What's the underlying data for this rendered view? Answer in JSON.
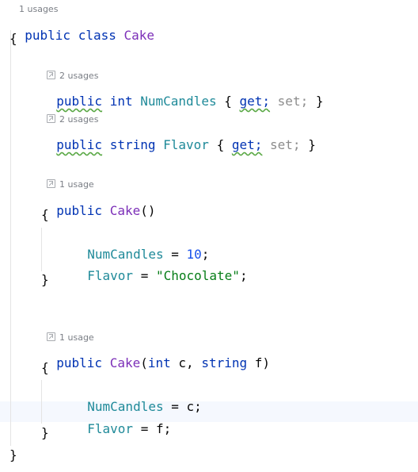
{
  "top_hint": "1 usages",
  "class_header": {
    "kw1": "public",
    "kw2": "class",
    "name": "Cake"
  },
  "brace_open": "{",
  "brace_close": "}",
  "hints": {
    "num_candles": "2 usages",
    "flavor": "2 usages",
    "ctor1": "1 usage",
    "ctor2": "1 usage"
  },
  "prop_num_candles": {
    "mod": "public",
    "type": "int",
    "name": "NumCandles",
    "open": "{",
    "get": "get;",
    "set": "set;",
    "close": "}"
  },
  "prop_flavor": {
    "mod": "public",
    "type": "string",
    "name": "Flavor",
    "open": "{",
    "get": "get;",
    "set": "set;",
    "close": "}"
  },
  "ctor1": {
    "mod": "public",
    "name": "Cake",
    "params": "()",
    "open": "{",
    "line1": {
      "target": "NumCandles",
      "op": " = ",
      "value": "10",
      "end": ";"
    },
    "line2": {
      "target": "Flavor",
      "op": " = ",
      "value": "\"Chocolate\"",
      "end": ";"
    },
    "close": "}"
  },
  "ctor2": {
    "mod": "public",
    "name": "Cake",
    "open_paren": "(",
    "p1_type": "int",
    "p1_name": " c, ",
    "p2_type": "string",
    "p2_name": " f",
    "close_paren": ")",
    "open": "{",
    "line1": {
      "target": "NumCandles",
      "op": " = ",
      "value": "c",
      "end": ";"
    },
    "line2": {
      "target": "Flavor",
      "op": " = ",
      "value": "f",
      "end": ";"
    },
    "close": "}"
  },
  "colors": {
    "keyword": "#0033b3",
    "class_name": "#7c2fb8",
    "property": "#1f8a99",
    "number": "#1750eb",
    "string": "#067d17",
    "inlay_hint": "#7a7e85",
    "current_line": "#f5f8fe"
  }
}
